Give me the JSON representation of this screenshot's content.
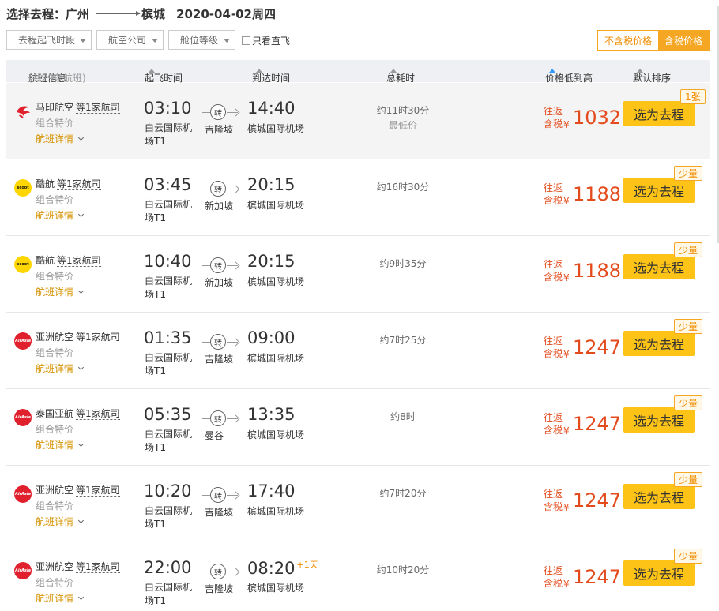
{
  "title": {
    "prefix": "选择去程：",
    "from": "广州",
    "to": "槟城",
    "date": "2020-04-02周四"
  },
  "filters": {
    "time": "去程起飞时段",
    "airline": "航空公司",
    "cabin": "舱位等级",
    "direct": "只看直飞",
    "excl_tax": "不含税价格",
    "incl_tax": "含税价格"
  },
  "header": {
    "info": "航班信息",
    "count": "(共29条航班)",
    "dep": "起飞时间",
    "arr": "到达时间",
    "dur": "总耗时",
    "price": "价格低到高",
    "default": "默认排序"
  },
  "accent": "#fdc316",
  "price_color": "#e34b1c",
  "flights": [
    {
      "logo": "malindo-logo-icon",
      "airline": "马印航空",
      "more": "等1家航司",
      "combo": "组合特价",
      "details": "航班详情",
      "dep": "03:10",
      "dap": "白云国际机场T1",
      "via": "吉隆坡",
      "transfer": "转",
      "arr": "14:40",
      "plus": "",
      "aap": "槟城国际机场",
      "dur": "约11时30分",
      "note": "最低价",
      "pt1": "往返",
      "pt2": "含税",
      "yen": "¥",
      "price": "1032",
      "btn": "选为去程",
      "badge": "1张"
    },
    {
      "logo": "scoot-logo-icon",
      "logo_text": "scoot",
      "airline": "酷航",
      "more": "等1家航司",
      "combo": "组合特价",
      "details": "航班详情",
      "dep": "03:45",
      "dap": "白云国际机场T1",
      "via": "新加坡",
      "transfer": "转",
      "arr": "20:15",
      "plus": "",
      "aap": "槟城国际机场",
      "dur": "约16时30分",
      "note": "",
      "pt1": "往返",
      "pt2": "含税",
      "yen": "¥",
      "price": "1188",
      "btn": "选为去程",
      "badge": "少量"
    },
    {
      "logo": "scoot-logo-icon",
      "logo_text": "scoot",
      "airline": "酷航",
      "more": "等1家航司",
      "combo": "组合特价",
      "details": "航班详情",
      "dep": "10:40",
      "dap": "白云国际机场T1",
      "via": "新加坡",
      "transfer": "转",
      "arr": "20:15",
      "plus": "",
      "aap": "槟城国际机场",
      "dur": "约9时35分",
      "note": "",
      "pt1": "往返",
      "pt2": "含税",
      "yen": "¥",
      "price": "1188",
      "btn": "选为去程",
      "badge": "少量"
    },
    {
      "logo": "airasia-logo-icon",
      "logo_text": "AirAsia",
      "airline": "亚洲航空",
      "more": "等1家航司",
      "combo": "组合特价",
      "details": "航班详情",
      "dep": "01:35",
      "dap": "白云国际机场T1",
      "via": "吉隆坡",
      "transfer": "转",
      "arr": "09:00",
      "plus": "",
      "aap": "槟城国际机场",
      "dur": "约7时25分",
      "note": "",
      "pt1": "往返",
      "pt2": "含税",
      "yen": "¥",
      "price": "1247",
      "btn": "选为去程",
      "badge": "少量"
    },
    {
      "logo": "airasia-logo-icon",
      "logo_text": "AirAsia",
      "airline": "泰国亚航",
      "more": "等1家航司",
      "combo": "组合特价",
      "details": "航班详情",
      "dep": "05:35",
      "dap": "白云国际机场T1",
      "via": "曼谷",
      "transfer": "转",
      "arr": "13:35",
      "plus": "",
      "aap": "槟城国际机场",
      "dur": "约8时",
      "note": "",
      "pt1": "往返",
      "pt2": "含税",
      "yen": "¥",
      "price": "1247",
      "btn": "选为去程",
      "badge": "少量"
    },
    {
      "logo": "airasia-logo-icon",
      "logo_text": "AirAsia",
      "airline": "亚洲航空",
      "more": "等1家航司",
      "combo": "组合特价",
      "details": "航班详情",
      "dep": "10:20",
      "dap": "白云国际机场T1",
      "via": "吉隆坡",
      "transfer": "转",
      "arr": "17:40",
      "plus": "",
      "aap": "槟城国际机场",
      "dur": "约7时20分",
      "note": "",
      "pt1": "往返",
      "pt2": "含税",
      "yen": "¥",
      "price": "1247",
      "btn": "选为去程",
      "badge": "少量"
    },
    {
      "logo": "airasia-logo-icon",
      "logo_text": "AirAsia",
      "airline": "亚洲航空",
      "more": "等1家航司",
      "combo": "组合特价",
      "details": "航班详情",
      "dep": "22:00",
      "dap": "白云国际机场T1",
      "via": "吉隆坡",
      "transfer": "转",
      "arr": "08:20",
      "plus": "+1天",
      "aap": "槟城国际机场",
      "dur": "约10时20分",
      "note": "",
      "pt1": "往返",
      "pt2": "含税",
      "yen": "¥",
      "price": "1247",
      "btn": "选为去程",
      "badge": "少量"
    }
  ]
}
